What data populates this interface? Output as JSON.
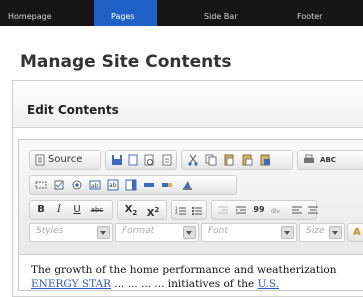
{
  "top_nav": {
    "items": [
      {
        "label": "Homepage"
      },
      {
        "label": "Pages",
        "active": true
      },
      {
        "label": "Side Bar"
      },
      {
        "label": "Footer"
      }
    ]
  },
  "page_title": "Manage Site Contents",
  "panel": {
    "title": "Edit Contents"
  },
  "editor": {
    "toolbar": {
      "source_label": "Source",
      "bold": "B",
      "italic": "I",
      "underline": "U",
      "strike": "abc",
      "subscript": "X",
      "subscript_mark": "2",
      "superscript": "X",
      "superscript_mark": "2",
      "blockquote": "99",
      "spell": "ABC"
    },
    "combos": {
      "styles": "Styles",
      "format": "Format",
      "font": "Font",
      "size": "Size",
      "text_color": "A"
    },
    "content": {
      "line1": "The growth of the home performance and weatherization",
      "line2_link": "ENERGY STAR",
      "line2_rest": " ... ... ... ... initiatives of the",
      "line2_link2": "U.S."
    }
  },
  "colors": {
    "nav_bg": "#161616",
    "nav_active": "#1f61c6",
    "link": "#2957c9"
  }
}
